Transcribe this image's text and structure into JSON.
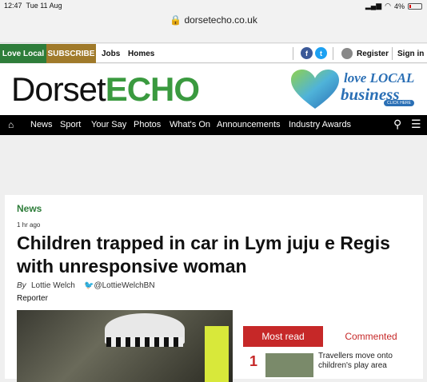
{
  "status": {
    "time": "12:47",
    "date": "Tue 11 Aug",
    "battery": "4%"
  },
  "browser": {
    "url": "dorsetecho.co.uk"
  },
  "topnav": {
    "love_local": "Love Local",
    "subscribe": "SUBSCRIBE",
    "jobs": "Jobs",
    "homes": "Homes",
    "register": "Register",
    "sign_in": "Sign in"
  },
  "masthead": {
    "logo_a": "Dorset",
    "logo_b": "ECHO",
    "ad_line1": "love LOCAL",
    "ad_line2": "business",
    "ad_click": "CLICK HERE"
  },
  "mainnav": [
    "News",
    "Sport",
    "Your Say",
    "Photos",
    "What's On",
    "Announcements",
    "Industry Awards"
  ],
  "article": {
    "category": "News",
    "time": "1 hr ago",
    "headline": "Children trapped in car in Lym juju e Regis with unresponsive woman",
    "by": "By",
    "author": "Lottie Welch",
    "twitter": "@LottieWelchBN",
    "role": "Reporter"
  },
  "sidebar": {
    "tab_most_read": "Most read",
    "tab_commented": "Commented",
    "item_number": "1",
    "item_text": "Travellers move onto children's play area"
  },
  "colors": {
    "green": "#2e7d3a",
    "red": "#c62828",
    "brand_blue": "#2a6fb5"
  }
}
